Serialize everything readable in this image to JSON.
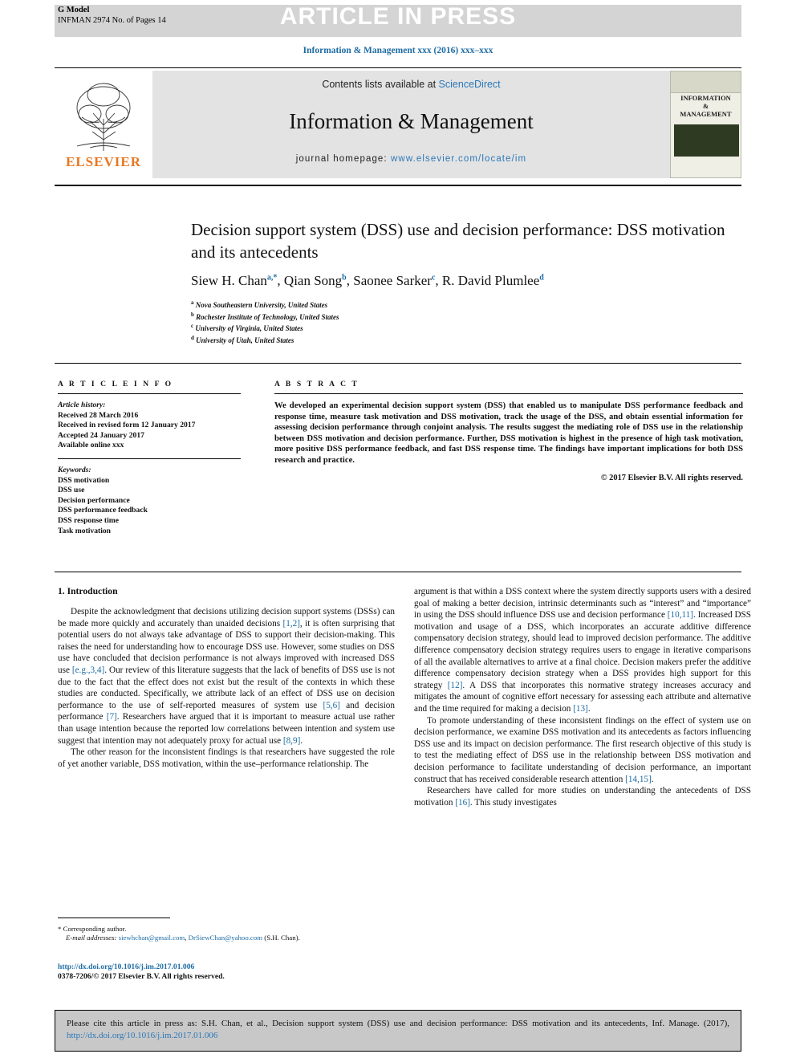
{
  "header": {
    "g_model": "G Model",
    "g_model_sub": "INFMAN 2974 No. of Pages 14",
    "article_in_press": "ARTICLE IN PRESS",
    "running_head": "Information & Management xxx (2016) xxx–xxx"
  },
  "masthead": {
    "contents_prefix": "Contents lists available at ",
    "contents_link": "ScienceDirect",
    "journal_title": "Information & Management",
    "homepage_label": "journal homepage: ",
    "homepage_url": "www.elsevier.com/locate/im",
    "publisher": "ELSEVIER",
    "cover_line1": "INFORMATION",
    "cover_line2": "&",
    "cover_line3": "MANAGEMENT"
  },
  "article": {
    "title": "Decision support system (DSS) use and decision performance: DSS motivation and its antecedents",
    "authors_html": "Siew H. Chan<sup>a,*</sup>, Qian Song<sup>b</sup>, Saonee Sarker<sup>c</sup>, R. David Plumlee<sup>d</sup>",
    "affiliations": [
      {
        "mark": "a",
        "text": "Nova Southeastern University, United States"
      },
      {
        "mark": "b",
        "text": "Rochester Institute of Technology, United States"
      },
      {
        "mark": "c",
        "text": "University of Virginia, United States"
      },
      {
        "mark": "d",
        "text": "University of Utah, United States"
      }
    ]
  },
  "info": {
    "heading": "A R T I C L E  I N F O",
    "history_label": "Article history:",
    "history": [
      "Received 28 March 2016",
      "Received in revised form 12 January 2017",
      "Accepted 24 January 2017",
      "Available online xxx"
    ],
    "keywords_label": "Keywords:",
    "keywords": [
      "DSS motivation",
      "DSS use",
      "Decision performance",
      "DSS performance feedback",
      "DSS response time",
      "Task motivation"
    ]
  },
  "abstract": {
    "heading": "A B S T R A C T",
    "text": "We developed an experimental decision support system (DSS) that enabled us to manipulate DSS performance feedback and response time, measure task motivation and DSS motivation, track the usage of the DSS, and obtain essential information for assessing decision performance through conjoint analysis. The results suggest the mediating role of DSS use in the relationship between DSS motivation and decision performance. Further, DSS motivation is highest in the presence of high task motivation, more positive DSS performance feedback, and fast DSS response time. The findings have important implications for both DSS research and practice.",
    "copyright": "© 2017 Elsevier B.V. All rights reserved."
  },
  "body": {
    "section_heading": "1. Introduction",
    "left_paragraphs": [
      {
        "segments": [
          {
            "t": "Despite the acknowledgment that decisions utilizing decision support systems (DSSs) can be made more quickly and accurately than unaided decisions "
          },
          {
            "t": "[1,2]",
            "ref": true
          },
          {
            "t": ", it is often surprising that potential users do not always take advantage of DSS to support their decision-making. This raises the need for understanding how to encourage DSS use. However, some studies on DSS use have concluded that decision performance is not always improved with increased DSS use "
          },
          {
            "t": "[e.g.,3,4]",
            "ref": true
          },
          {
            "t": ". Our review of this literature suggests that the lack of benefits of DSS use is not due to the fact that the effect does not exist but the result of the contexts in which these studies are conducted. Specifically, we attribute lack of an effect of DSS use on decision performance to the use of self-reported measures of system use "
          },
          {
            "t": "[5,6]",
            "ref": true
          },
          {
            "t": " and decision performance "
          },
          {
            "t": "[7]",
            "ref": true
          },
          {
            "t": ". Researchers have argued that it is important to measure actual use rather than usage intention because the reported low correlations between intention and system use suggest that intention may not adequately proxy for actual use "
          },
          {
            "t": "[8,9]",
            "ref": true
          },
          {
            "t": "."
          }
        ]
      },
      {
        "segments": [
          {
            "t": "The other reason for the inconsistent findings is that researchers have suggested the role of yet another variable, DSS motivation, within the use–performance relationship. The"
          }
        ]
      }
    ],
    "right_paragraphs": [
      {
        "continued": true,
        "segments": [
          {
            "t": "argument is that within a DSS context where the system directly supports users with a desired goal of making a better decision, intrinsic determinants such as “interest” and “importance” in using the DSS should influence DSS use and decision performance "
          },
          {
            "t": "[10,11]",
            "ref": true
          },
          {
            "t": ". Increased DSS motivation and usage of a DSS, which incorporates an accurate additive difference compensatory decision strategy, should lead to improved decision performance. The additive difference compensatory decision strategy requires users to engage in iterative comparisons of all the available alternatives to arrive at a final choice. Decision makers prefer the additive difference compensatory decision strategy when a DSS provides high support for this strategy "
          },
          {
            "t": "[12]",
            "ref": true
          },
          {
            "t": ". A DSS that incorporates this normative strategy increases accuracy and mitigates the amount of cognitive effort necessary for assessing each attribute and alternative and the time required for making a decision "
          },
          {
            "t": "[13]",
            "ref": true
          },
          {
            "t": "."
          }
        ]
      },
      {
        "segments": [
          {
            "t": "To promote understanding of these inconsistent findings on the effect of system use on decision performance, we examine DSS motivation and its antecedents as factors influencing DSS use and its impact on decision performance. The first research objective of this study is to test the mediating effect of DSS use in the relationship between DSS motivation and decision performance to facilitate understanding of decision performance, an important construct that has received considerable research attention "
          },
          {
            "t": "[14,15]",
            "ref": true
          },
          {
            "t": "."
          }
        ]
      },
      {
        "segments": [
          {
            "t": "Researchers have called for more studies on understanding the antecedents of DSS motivation "
          },
          {
            "t": "[16]",
            "ref": true
          },
          {
            "t": ". This study investigates"
          }
        ]
      }
    ]
  },
  "footnote": {
    "corresponding_mark": "*",
    "corresponding_text": "Corresponding author.",
    "email_label": "E-mail addresses:",
    "email1": "siewhchan@gmail.com",
    "email2": "DrSiewChan@yahoo.com",
    "email_suffix": "(S.H. Chan).",
    "doi": "http://dx.doi.org/10.1016/j.im.2017.01.006",
    "issn_line": "0378-7206/© 2017 Elsevier B.V. All rights reserved."
  },
  "citation_box": {
    "text_before": "Please cite this article in press as: S.H. Chan, et al., Decision support system (DSS) use and decision performance: DSS motivation and its antecedents, Inf. Manage. (2017), ",
    "link": "http://dx.doi.org/10.1016/j.im.2017.01.006"
  },
  "colors": {
    "link_blue": "#2b78b8",
    "ref_blue": "#1e6ca4",
    "elsevier_orange": "#e87722",
    "band_grey": "#d4d4d4",
    "mast_grey": "#e3e3e3",
    "cite_grey": "#c8c8c8"
  }
}
